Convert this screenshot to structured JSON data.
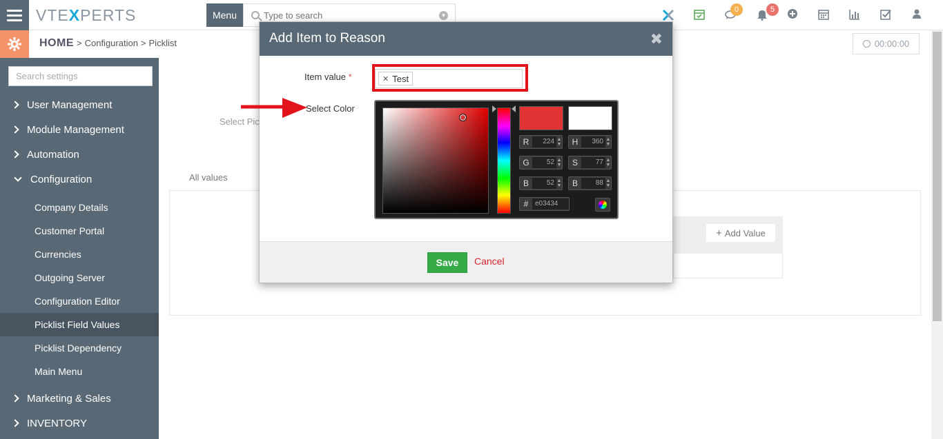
{
  "topbar": {
    "logo_prefix": "VTE",
    "logo_x": "X",
    "logo_suffix": "PERTS",
    "menu_label": "Menu",
    "search_placeholder": "Type to search",
    "chat_badge": "0",
    "notif_badge": "5"
  },
  "breadcrumb": {
    "home": "HOME",
    "sep1": ">",
    "item1": "Configuration",
    "sep2": ">",
    "item2": "Picklist"
  },
  "timer": "00:00:00",
  "sidebar": {
    "search_placeholder": "Search settings",
    "sections": [
      {
        "label": "User Management"
      },
      {
        "label": "Module Management"
      },
      {
        "label": "Automation"
      },
      {
        "label": "Configuration"
      },
      {
        "label": "Marketing & Sales"
      },
      {
        "label": "INVENTORY"
      }
    ],
    "config_items": [
      {
        "label": "Company Details"
      },
      {
        "label": "Customer Portal"
      },
      {
        "label": "Currencies"
      },
      {
        "label": "Outgoing Server"
      },
      {
        "label": "Configuration Editor"
      },
      {
        "label": "Picklist Field Values"
      },
      {
        "label": "Picklist Dependency"
      },
      {
        "label": "Main Menu"
      }
    ]
  },
  "main": {
    "select_label_partial": "Select Pic",
    "tab_all_values": "All values",
    "add_value": "Add Value"
  },
  "modal": {
    "title": "Add Item to Reason",
    "close": "✖",
    "item_value_label": "Item value",
    "required_mark": "*",
    "tag_value": "Test",
    "select_color_label": "Select Color",
    "save": "Save",
    "cancel": "Cancel"
  },
  "colorpicker": {
    "new_color": "#e03434",
    "current_color": "#ffffff",
    "hue_color": "#e00000",
    "r_label": "R",
    "r": "224",
    "g_label": "G",
    "g": "52",
    "b_label": "B",
    "b": "52",
    "h_label": "H",
    "h": "360",
    "s_label": "S",
    "s": "77",
    "v_label": "B",
    "v": "88",
    "hex_label": "#",
    "hex": "e03434"
  },
  "colors": {
    "sidebar_bg": "#596875",
    "accent_orange": "#f6926a",
    "save_green": "#35aa47",
    "cancel_red": "#d9232d",
    "annotation_red": "#e3131b"
  }
}
